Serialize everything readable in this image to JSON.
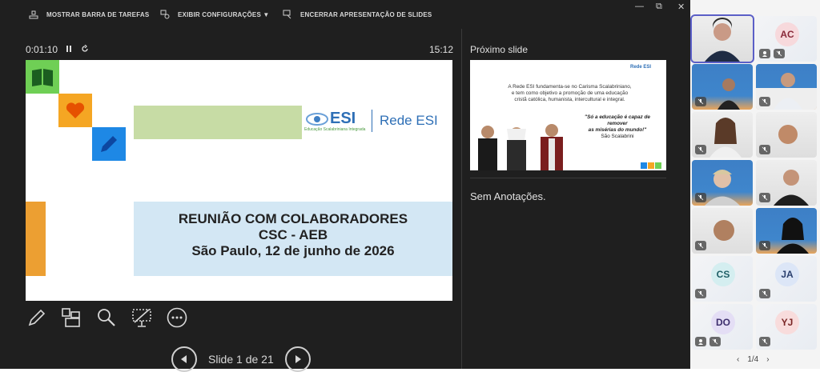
{
  "toolbar": {
    "taskbar_label": "MOSTRAR BARRA DE TAREFAS",
    "display_settings_label": "EXIBIR CONFIGURAÇÕES ▼",
    "end_show_label": "ENCERRAR APRESENTAÇÃO DE SLIDES"
  },
  "window_controls": {
    "minimize": "—",
    "restore": "⧉",
    "close": "✕"
  },
  "timer": {
    "elapsed": "0:01:10",
    "clock": "15:12"
  },
  "slide": {
    "title_line1": "REUNIÃO COM COLABORADORES",
    "title_line2": "CSC - AEB",
    "title_line3": "São Paulo, 12 de junho de 2026",
    "logo_text": "ESI",
    "logo_sub": "Educação Scalabriniana Integrada",
    "logo_brand": "Rede ESI"
  },
  "navigation": {
    "slide_counter": "Slide 1 de 21"
  },
  "next": {
    "header": "Próximo slide",
    "body_line1": "A Rede ESI fundamenta-se no Carisma Scalabriniano,",
    "body_line2": "e tem como objetivo a promoção de uma educação",
    "body_line3": "cristã católica, humanista, intercultural e integral.",
    "quote_line1": "\"Só a educação é capaz de",
    "quote_line2": "remover",
    "quote_line3": "as misérias do mundo!\"",
    "quote_author": "São Scalabrini",
    "logo_brand": "Rede ESI"
  },
  "notes": {
    "text": "Sem Anotações."
  },
  "participants": {
    "ac": "AC",
    "cs": "CS",
    "ja": "JA",
    "do": "DO",
    "yj": "YJ",
    "pager": "1/4",
    "prev": "‹",
    "next": "›"
  },
  "colors": {
    "accent": "#5b5fc7",
    "green_tile": "#6fcf55",
    "orange_tile": "#f5a623",
    "blue_tile": "#1e88e5"
  }
}
